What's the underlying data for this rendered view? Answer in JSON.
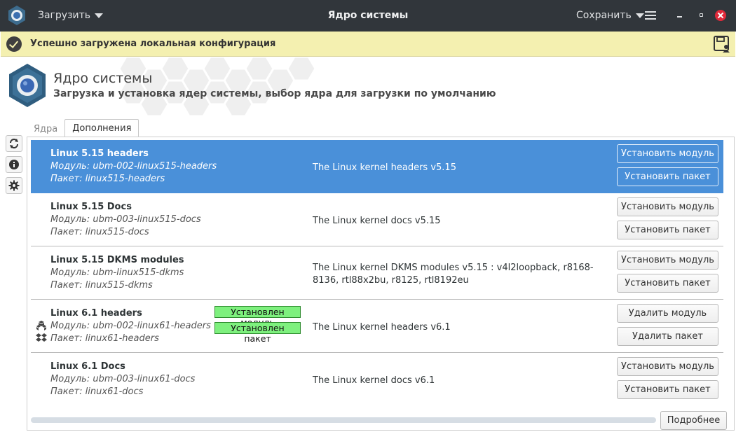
{
  "titlebar": {
    "load_menu": "Загрузить",
    "title": "Ядро системы",
    "save_menu": "Сохранить"
  },
  "notification": {
    "text": "Успешно загружена локальная конфигурация"
  },
  "header": {
    "title": "Ядро системы",
    "subtitle": "Загрузка и установка ядер системы, выбор ядра для загрузки по умолчанию"
  },
  "tabs": [
    "Ядра",
    "Дополнения"
  ],
  "active_tab": "Дополнения",
  "rows": [
    {
      "name": "Linux 5.15 headers",
      "module": "Модуль: ubm-002-linux515-headers",
      "package": "Пакет: linux515-headers",
      "description": "The Linux kernel headers v5.15",
      "button_module": "Установить модуль",
      "button_package": "Установить пакет",
      "selected": true
    },
    {
      "name": "Linux 5.15 Docs",
      "module": "Модуль: ubm-003-linux515-docs",
      "package": "Пакет: linux515-docs",
      "description": "The Linux kernel docs v5.15",
      "button_module": "Установить модуль",
      "button_package": "Установить пакет",
      "selected": false
    },
    {
      "name": "Linux 5.15 DKMS modules",
      "module": "Модуль: ubm-linux515-dkms",
      "package": "Пакет: linux515-dkms",
      "description": "The Linux kernel DKMS modules v5.15 : v4l2loopback, r8168-8136, rtl88x2bu, r8125, rtl8192eu",
      "button_module": "Установить модуль",
      "button_package": "Установить пакет",
      "selected": false
    },
    {
      "name": "Linux 6.1 headers",
      "module": "Модуль: ubm-002-linux61-headers",
      "package": "Пакет: linux61-headers",
      "description": "The Linux kernel headers v6.1",
      "badge_module": "Установлен модуль",
      "badge_package": "Установлен пакет",
      "button_module": "Удалить модуль",
      "button_package": "Удалить пакет",
      "selected": false
    },
    {
      "name": "Linux 6.1 Docs",
      "module": "Модуль: ubm-003-linux61-docs",
      "package": "Пакет: linux61-docs",
      "description": "The Linux kernel docs v6.1",
      "button_module": "Установить модуль",
      "button_package": "Установить пакет",
      "selected": false
    }
  ],
  "footer": {
    "more_button": "Подробнее"
  },
  "icons": {
    "app": "gear-icon",
    "refresh": "refresh-icon",
    "info": "info-icon",
    "settings": "gear-icon",
    "save_profile": "save-profile-icon",
    "module_installed": "cubes-icon",
    "package_installed": "dropbox-icon"
  },
  "colors": {
    "titlebar": "#31363b",
    "notification": "#f4f0b0",
    "selection": "#4a90d9",
    "installed_badge": "#7ef07e",
    "close_button": "#e0293a"
  }
}
